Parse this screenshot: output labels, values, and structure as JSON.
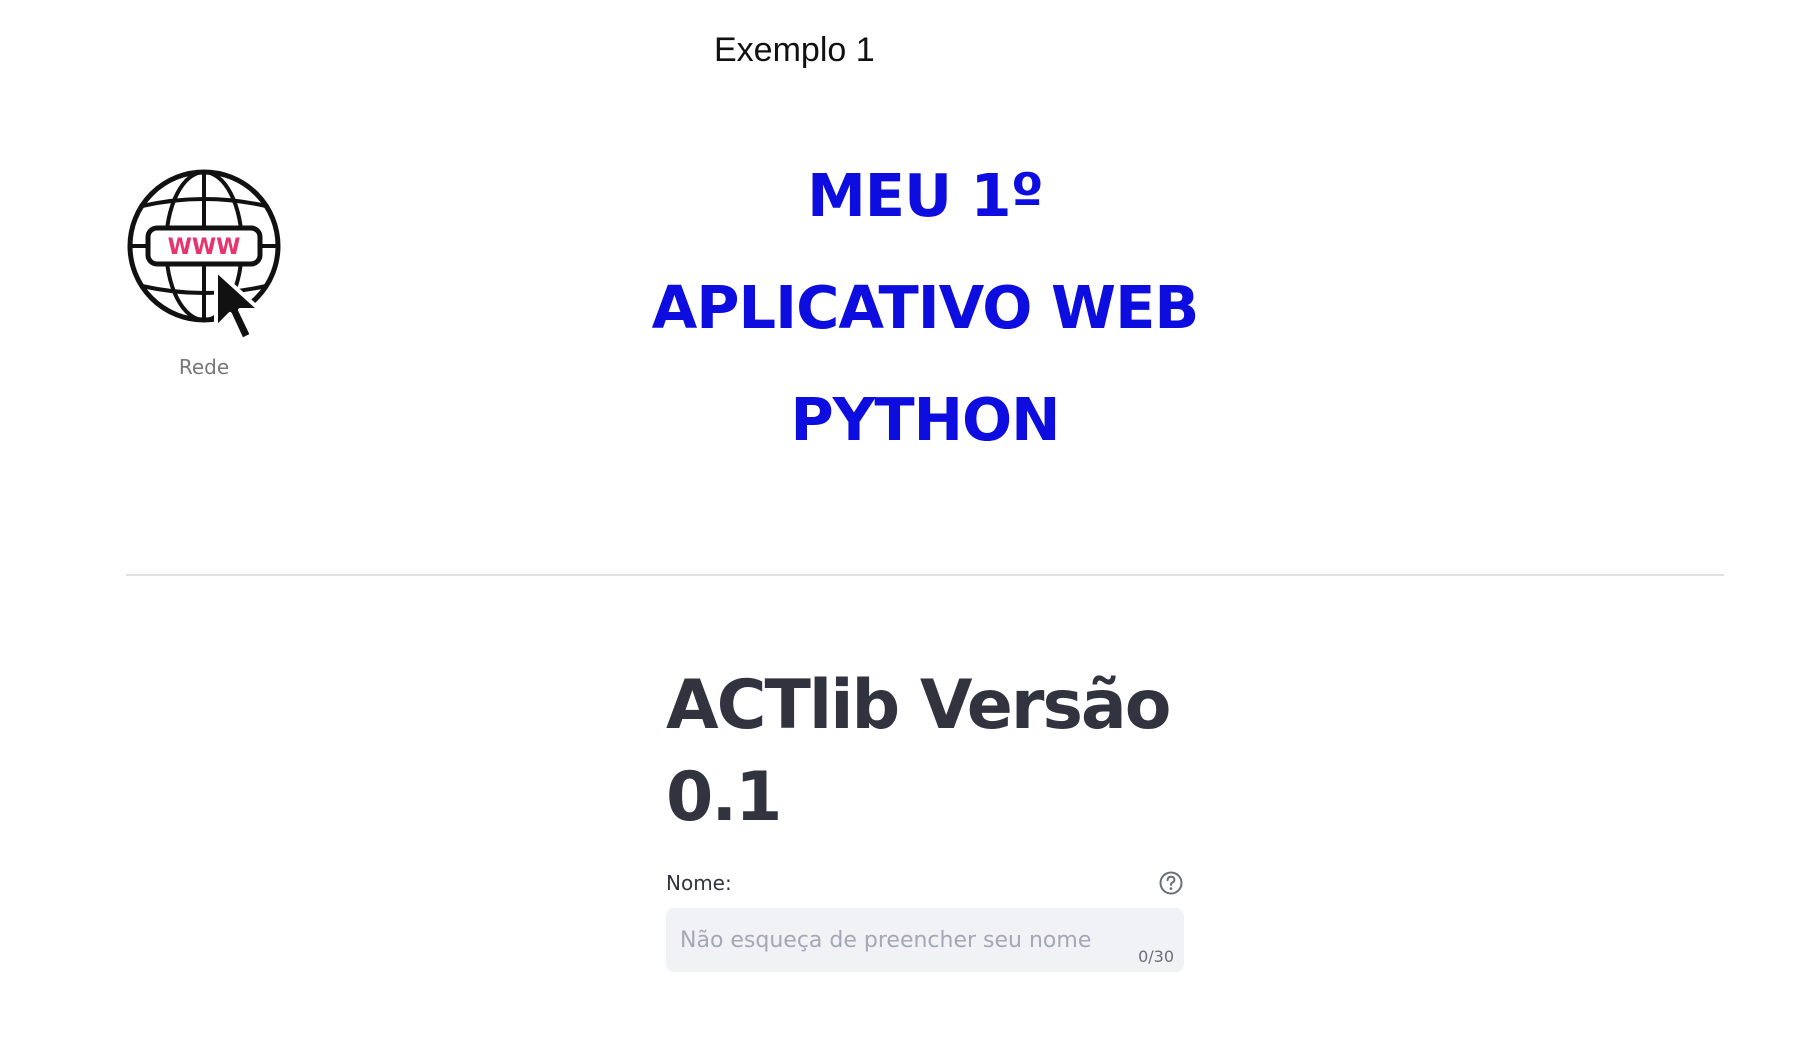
{
  "header": {
    "example_title": "Exemplo 1"
  },
  "logo": {
    "icon": "globe-cursor-www-icon",
    "badge_text": "WWW",
    "caption": "Rede"
  },
  "hero": {
    "lines": [
      "MEU 1º",
      "APLICATIVO WEB",
      "PYTHON"
    ],
    "color": "#0d0de0"
  },
  "main": {
    "title": "ACTlib Versão 0.1",
    "name_field": {
      "label": "Nome:",
      "placeholder": "Não esqueça de preencher seu nome",
      "value": "",
      "counter": "0/30"
    }
  },
  "colors": {
    "text": "#31333f",
    "input_bg": "#f0f2f6",
    "divider": "#e1e1e4",
    "badge": "#e8336d"
  }
}
